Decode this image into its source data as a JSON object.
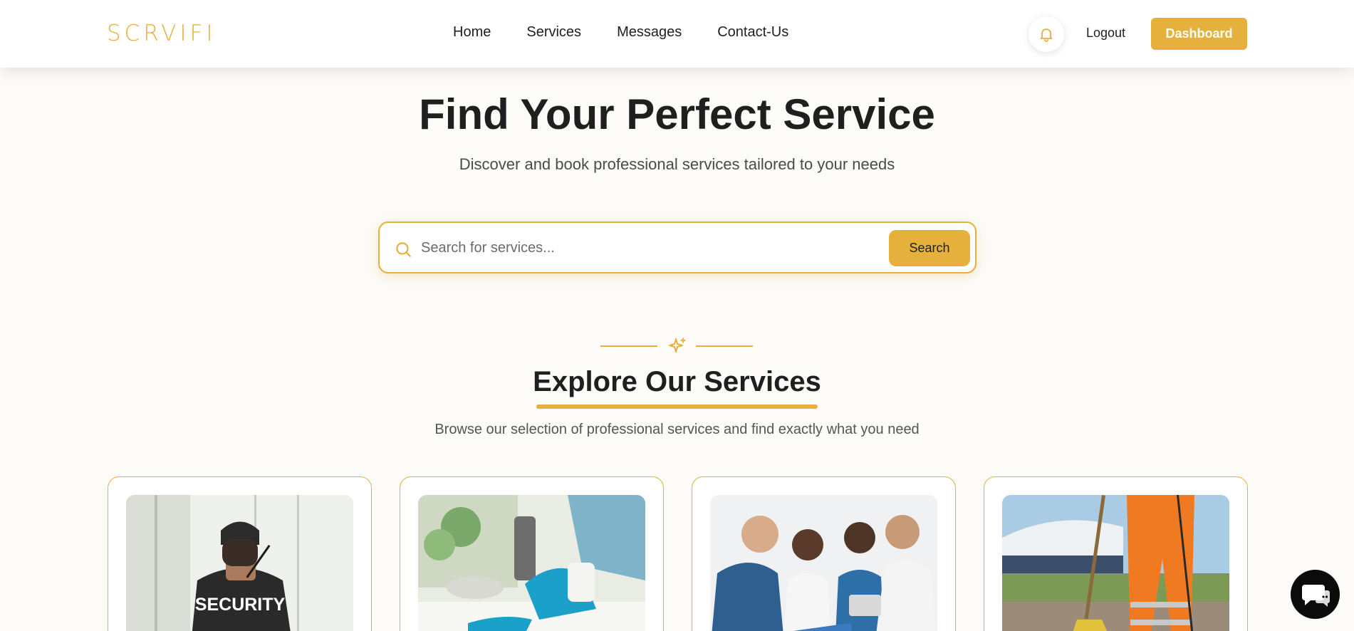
{
  "header": {
    "logo": "SCRVIFI",
    "nav": [
      "Home",
      "Services",
      "Messages",
      "Contact-Us"
    ],
    "logout": "Logout",
    "dashboard": "Dashboard"
  },
  "hero": {
    "title": "Find Your Perfect Service",
    "subtitle": "Discover and book professional services tailored to your needs",
    "search_placeholder": "Search for services...",
    "search_button": "Search"
  },
  "section": {
    "title": "Explore Our Services",
    "subtitle": "Browse our selection of professional services and find exactly what you need"
  },
  "cards": [
    {
      "image": "security-guard-photo",
      "overlay_text": "SECURITY"
    },
    {
      "image": "cleaning-photo"
    },
    {
      "image": "medical-team-photo"
    },
    {
      "image": "street-sweeper-photo"
    }
  ],
  "colors": {
    "accent": "#e5b03c",
    "text": "#1f1f1f",
    "background": "#fcfbf7"
  }
}
